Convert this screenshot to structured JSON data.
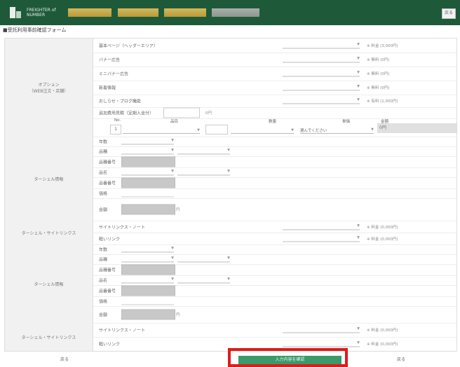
{
  "header": {
    "logo_text": "FREIGHTER of NUMBER",
    "right_button": "戻る"
  },
  "page_title": "■受託利用事前確認フォーム",
  "sections": {
    "s1": {
      "label": "オプション",
      "sub": "（WEB注文・店舗）"
    },
    "s2": {
      "label": "ターシェル情報"
    },
    "s3": {
      "label": "ターシェル・サイトリンクス"
    },
    "s4": {
      "label": "ターシェル情報"
    },
    "s5": {
      "label": "ターシェル・サイトリンクス"
    }
  },
  "s1_rows": [
    {
      "label": "基本ページ（ヘッダーエリア）",
      "note": "※ 料金 (3,000円)"
    },
    {
      "label": "バナー広告",
      "note": "※ 無料 (0円)"
    },
    {
      "label": "ミニバナー広告",
      "note": "※ 無料 (0円)"
    },
    {
      "label": "新着情報",
      "note": "※ 無料 (0円)"
    },
    {
      "label": "おしらせ・ブログ機能",
      "note": "※ 有料 (1,000円)"
    }
  ],
  "s1_extra": {
    "label": "追加費用見積（定期入金分）",
    "value": "0円"
  },
  "s1_table": {
    "headers": [
      "No.",
      "品目",
      "数量",
      "単価",
      "金額"
    ],
    "row": {
      "no": "1",
      "value": "1",
      "select": "選んでください",
      "amount": "0円"
    }
  },
  "s2_rows": [
    "年数",
    "品種",
    "品種番号",
    "品名",
    "品番番号",
    "価格",
    "金額"
  ],
  "s2_unit": "円",
  "s3_rows": [
    {
      "label": "サイトリンクス・ノート",
      "note": "※ 料金 (0,000円)"
    },
    {
      "label": "軽いリンク",
      "note": "※ 料金 (0,000円)"
    }
  ],
  "s4_rows": [
    "年数",
    "品種",
    "品種番号",
    "品名",
    "品番番号",
    "価格",
    "金額"
  ],
  "s4_unit": "円",
  "s5_rows": [
    {
      "label": "サイトリンクス・ノート",
      "note": "※ 料金 (0,000円)"
    },
    {
      "label": "軽いリンク",
      "note": "※ 料金 (0,000円)"
    }
  ],
  "select_placeholder": "-",
  "footer": {
    "left": "戻る",
    "submit": "入力内容を確認",
    "right": "戻る"
  },
  "colors": {
    "header_bg": "#1e5a3a",
    "submit_bg": "#3a9a6a",
    "highlight": "#e01a1a"
  }
}
